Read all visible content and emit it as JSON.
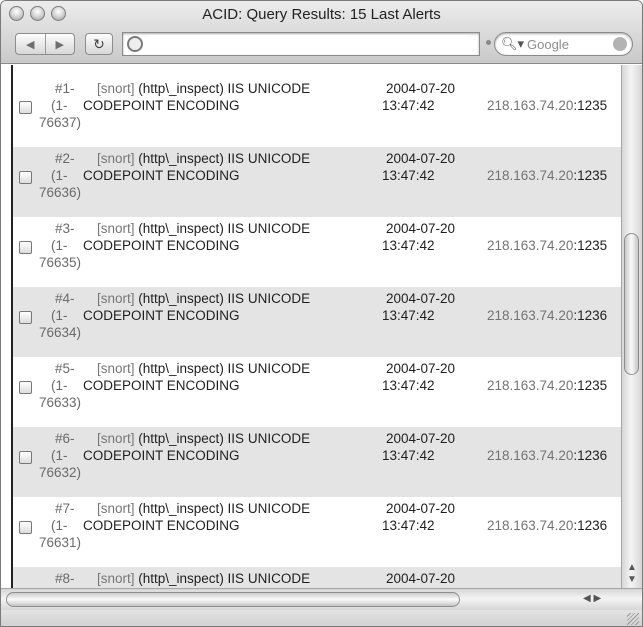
{
  "window": {
    "title": "ACID: Query Results: 15 Last Alerts"
  },
  "toolbar": {
    "back_icon": "back-arrow-icon",
    "forward_icon": "forward-arrow-icon",
    "reload_icon": "reload-icon",
    "address_value": "",
    "search_placeholder": "Google"
  },
  "alerts": [
    {
      "num_a": "#1-",
      "num_b": "(1-",
      "num_c": "76637)",
      "sensor": "[snort]",
      "sig_a": " (http\\_inspect) IIS UNICODE",
      "sig_b": "CODEPOINT ENCODING",
      "date": "2004-07-20",
      "time": "13:47:42",
      "ip": "218.163.74.20",
      "port": ":1235"
    },
    {
      "num_a": "#2-",
      "num_b": "(1-",
      "num_c": "76636)",
      "sensor": "[snort]",
      "sig_a": " (http\\_inspect) IIS UNICODE",
      "sig_b": "CODEPOINT ENCODING",
      "date": "2004-07-20",
      "time": "13:47:42",
      "ip": "218.163.74.20",
      "port": ":1235"
    },
    {
      "num_a": "#3-",
      "num_b": "(1-",
      "num_c": "76635)",
      "sensor": "[snort]",
      "sig_a": " (http\\_inspect) IIS UNICODE",
      "sig_b": "CODEPOINT ENCODING",
      "date": "2004-07-20",
      "time": "13:47:42",
      "ip": "218.163.74.20",
      "port": ":1235"
    },
    {
      "num_a": "#4-",
      "num_b": "(1-",
      "num_c": "76634)",
      "sensor": "[snort]",
      "sig_a": " (http\\_inspect) IIS UNICODE",
      "sig_b": "CODEPOINT ENCODING",
      "date": "2004-07-20",
      "time": "13:47:42",
      "ip": "218.163.74.20",
      "port": ":1236"
    },
    {
      "num_a": "#5-",
      "num_b": "(1-",
      "num_c": "76633)",
      "sensor": "[snort]",
      "sig_a": " (http\\_inspect) IIS UNICODE",
      "sig_b": "CODEPOINT ENCODING",
      "date": "2004-07-20",
      "time": "13:47:42",
      "ip": "218.163.74.20",
      "port": ":1235"
    },
    {
      "num_a": "#6-",
      "num_b": "(1-",
      "num_c": "76632)",
      "sensor": "[snort]",
      "sig_a": " (http\\_inspect) IIS UNICODE",
      "sig_b": "CODEPOINT ENCODING",
      "date": "2004-07-20",
      "time": "13:47:42",
      "ip": "218.163.74.20",
      "port": ":1236"
    },
    {
      "num_a": "#7-",
      "num_b": "(1-",
      "num_c": "76631)",
      "sensor": "[snort]",
      "sig_a": " (http\\_inspect) IIS UNICODE",
      "sig_b": "CODEPOINT ENCODING",
      "date": "2004-07-20",
      "time": "13:47:42",
      "ip": "218.163.74.20",
      "port": ":1236"
    },
    {
      "num_a": "#8-",
      "num_b": "",
      "num_c": "",
      "sensor": "[snort]",
      "sig_a": " (http\\_inspect) IIS UNICODE",
      "sig_b": "",
      "date": "2004-07-20",
      "time": "",
      "ip": "",
      "port": ""
    }
  ]
}
